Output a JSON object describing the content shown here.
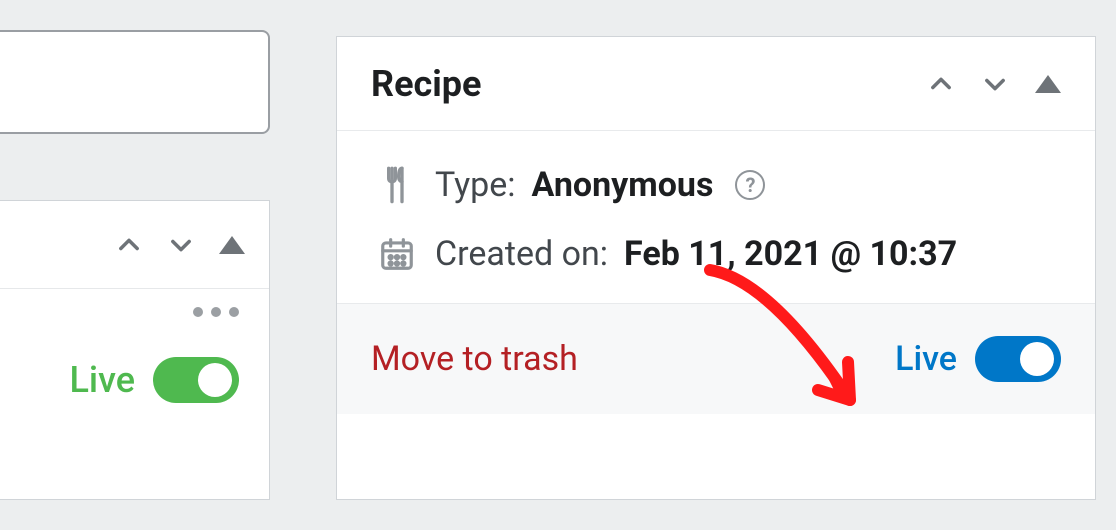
{
  "left": {
    "live_label": "Live"
  },
  "recipe": {
    "title": "Recipe",
    "type_label": "Type:",
    "type_value": "Anonymous",
    "created_label": "Created on:",
    "created_value": "Feb 11, 2021 @ 10:37",
    "trash_label": "Move to trash",
    "live_label": "Live"
  }
}
